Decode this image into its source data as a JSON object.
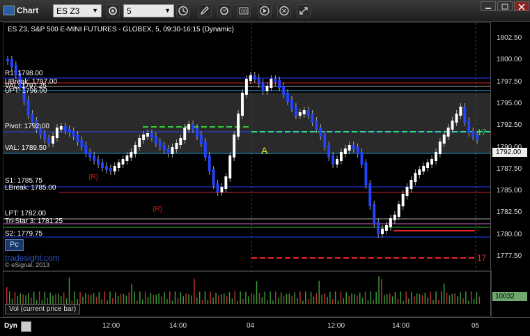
{
  "window": {
    "title": "Chart"
  },
  "toolbar": {
    "symbol": "ES Z3",
    "interval": "5"
  },
  "chart": {
    "header": "ES Z3, S&P 500 E-MINI FUTURES - GLOBEX, 5, 09:30-16:15 (Dynamic)",
    "current_price": "1792.00",
    "price_ticks": [
      "1802.50",
      "1800.00",
      "1797.50",
      "1795.00",
      "1792.50",
      "1790.00",
      "1787.50",
      "1785.00",
      "1782.50",
      "1780.00",
      "1777.50"
    ],
    "levels": {
      "r1": "R1: 1798.00",
      "ubreak": "UBreak: 1797.00",
      "val_top": "VAL: 1797.25",
      "upt": "UPT: 1796.00",
      "pivot": "Pivot: 1792.00",
      "val": "VAL: 1789.50",
      "s1": "S1: 1785.75",
      "lbreak": "LBreak: 1785.00",
      "lpt": "LPT: 1782.00",
      "tristar": "Tri-Star 3: 1781.25",
      "s2": "S2: 1779.75"
    },
    "markers": {
      "r1": "(R)",
      "r2": "(R)",
      "a": "A",
      "seventeen": "17"
    },
    "badge": "Pc",
    "watermark": "tradesight.com",
    "copyright": "© eSignal, 2013"
  },
  "volume": {
    "label": "Vol (current price bar)",
    "value": "10032"
  },
  "time_axis": {
    "labels": [
      "12:00",
      "14:00",
      "04",
      "12:00",
      "14:00",
      "05"
    ]
  },
  "footer": {
    "dyn": "Dyn"
  },
  "colors": {
    "up": "#ffffff",
    "down": "#2244ff",
    "vol_up": "#3a9a3a",
    "vol_down": "#c03030"
  }
}
